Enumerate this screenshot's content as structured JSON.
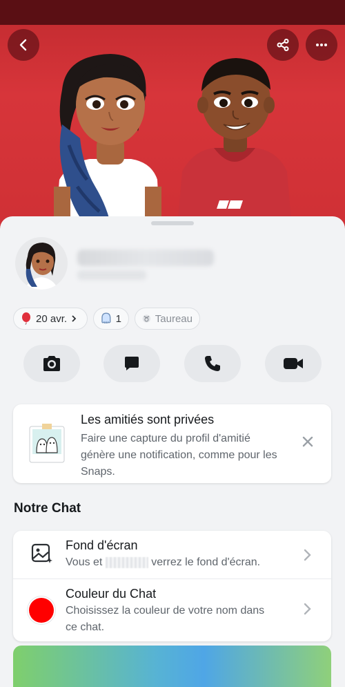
{
  "nav": {
    "back_icon": "chevron-left-icon",
    "share_icon": "share-icon",
    "more_icon": "more-horizontal-icon"
  },
  "profile": {
    "chips": [
      {
        "icon": "balloon-icon",
        "label": "20 avr.",
        "has_chevron": true
      },
      {
        "icon": "ghost-icon",
        "label": "1"
      },
      {
        "icon": "zodiac-taurus-icon",
        "label": "Taureau"
      }
    ],
    "actions": [
      "camera-icon",
      "chat-icon",
      "phone-icon",
      "video-icon"
    ]
  },
  "privacy": {
    "title": "Les amitiés sont privées",
    "body": "Faire une capture du profil d'amitié génère une notification, comme pour les Snaps."
  },
  "chat_section": {
    "title": "Notre Chat",
    "rows": [
      {
        "title": "Fond d'écran",
        "sub_prefix": "Vous et",
        "sub_suffix": "verrez le fond d'écran."
      },
      {
        "title": "Couleur du Chat",
        "sub": "Choisissez la couleur de votre nom dans ce chat.",
        "color": "#ff0000"
      }
    ]
  },
  "colors": {
    "hero_red": "#d7353a",
    "chat_color": "#ff0000"
  }
}
